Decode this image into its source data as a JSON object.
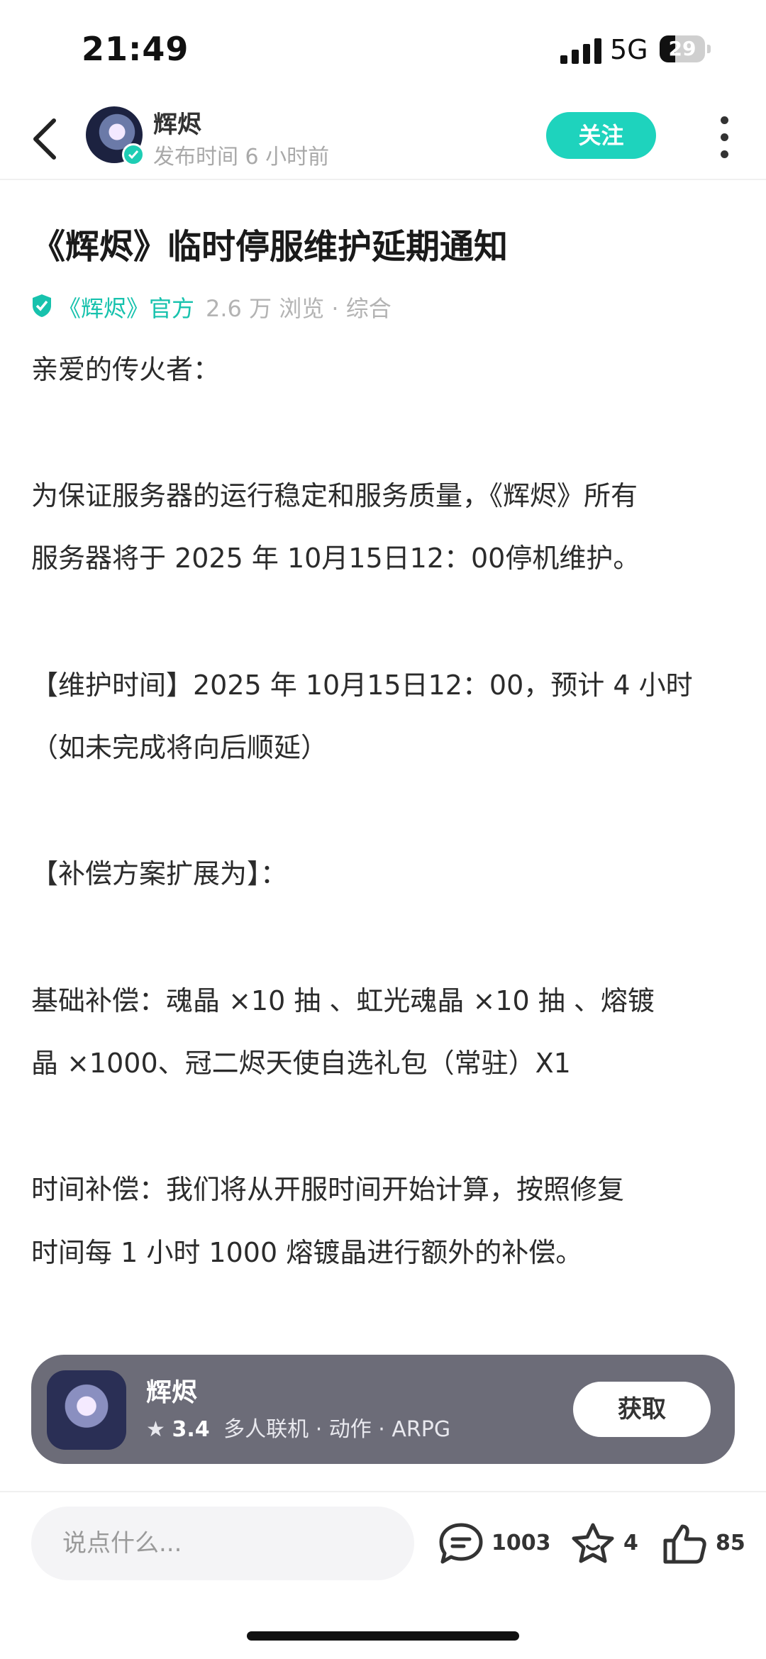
{
  "status_bar": {
    "time": "21:49",
    "network": "5G",
    "battery": "29"
  },
  "header": {
    "author": "辉烬",
    "post_time": "发布时间 6 小时前",
    "follow_label": "关注"
  },
  "article": {
    "title": "《辉烬》临时停服维护延期通知",
    "official_tag": "《辉烬》官方",
    "views": "2.6 万 浏览 · 综合",
    "lines": [
      "亲爱的传火者：",
      "为保证服务器的运行稳定和服务质量，《辉烬》所有",
      "服务器将于 2025 年 10月15日12：00停机维护。",
      "【维护时间】2025 年 10月15日12：00，预计 4 小时",
      "（如未完成将向后顺延）",
      "【补偿方案扩展为】：",
      "基础补偿：魂晶 ×10 抽 、虹光魂晶 ×10 抽 、熔镀",
      "晶 ×1000、冠二烬天使自选礼包（常驻）X1",
      "时间补偿：我们将从开服时间开始计算，按照修复",
      "时间每 1 小时 1000 熔镀晶进行额外的补偿。"
    ]
  },
  "app_card": {
    "name": "辉烬",
    "rating": "3.4",
    "tags": "多人联机 · 动作 · ARPG",
    "get_label": "获取"
  },
  "bottom_bar": {
    "comment_placeholder": "说点什么...",
    "comments": "1003",
    "favorites": "4",
    "likes": "85"
  },
  "colors": {
    "accent": "#1ed3bd",
    "card_bg": "#6c6c78"
  }
}
